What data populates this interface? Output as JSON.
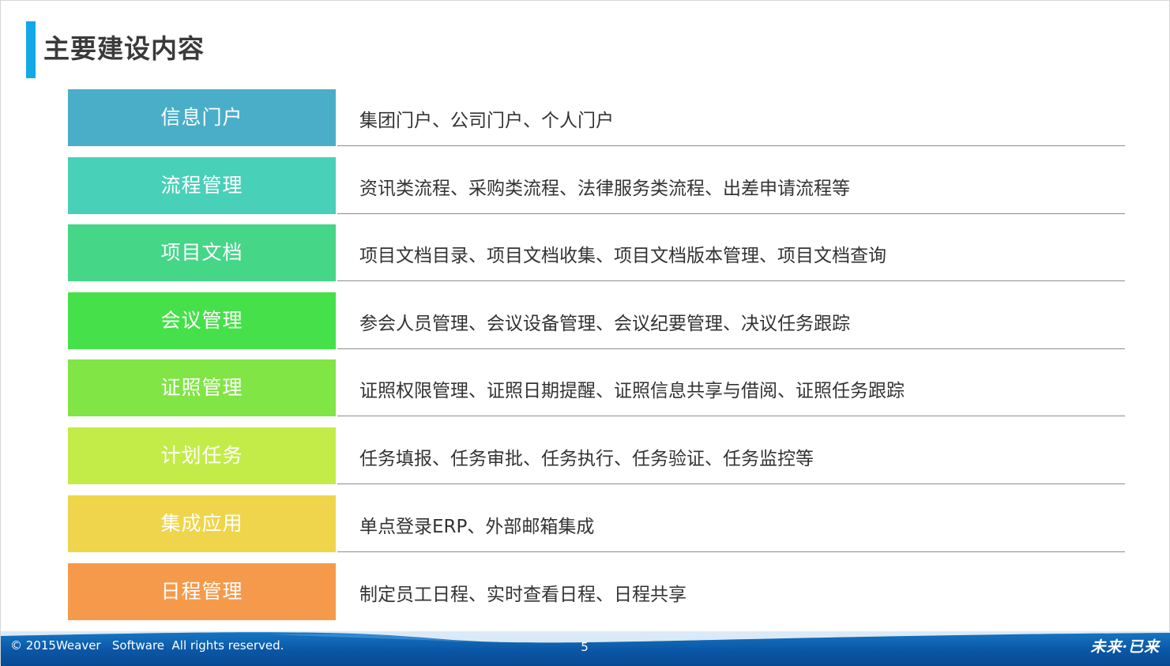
{
  "slide": {
    "title": "主要建设内容",
    "accent_color": "#13a8e8",
    "rows": [
      {
        "label": "信息门户",
        "color": "#4aaec9",
        "description": "集团门户、公司门户、个人门户"
      },
      {
        "label": "流程管理",
        "color": "#48d0b8",
        "description": "资讯类流程、采购类流程、法律服务类流程、出差申请流程等"
      },
      {
        "label": "项目文档",
        "color": "#45d688",
        "description": "项目文档目录、项目文档收集、项目文档版本管理、项目文档查询"
      },
      {
        "label": "会议管理",
        "color": "#46e04a",
        "description": "参会人员管理、会议设备管理、会议纪要管理、决议任务跟踪"
      },
      {
        "label": "证照管理",
        "color": "#80e545",
        "description": "证照权限管理、证照日期提醒、证照信息共享与借阅、证照任务跟踪"
      },
      {
        "label": "计划任务",
        "color": "#c4ec48",
        "description": "任务填报、任务审批、任务执行、任务验证、任务监控等"
      },
      {
        "label": "集成应用",
        "color": "#efd54b",
        "description": "单点登录ERP、外部邮箱集成"
      },
      {
        "label": "日程管理",
        "color": "#f59a4b",
        "description": "制定员工日程、实时查看日程、日程共享"
      }
    ]
  },
  "footer": {
    "copyright": "© 2015Weaver   Software  All rights reserved.",
    "page_number": "5",
    "slogan": "未来·已来"
  }
}
